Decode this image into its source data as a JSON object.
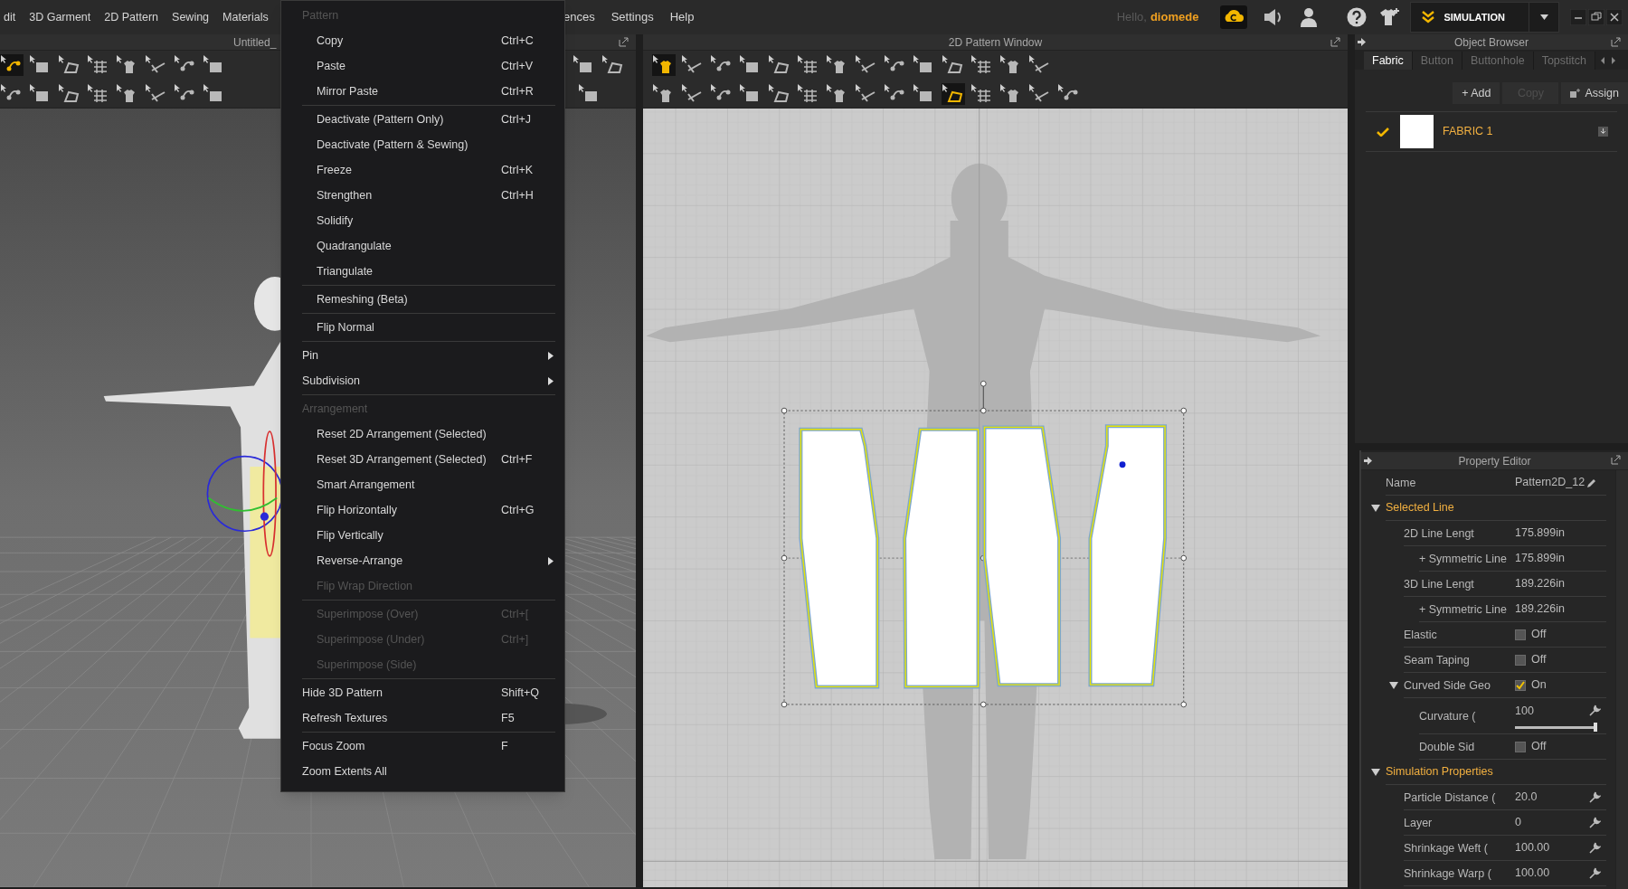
{
  "menu_bar": {
    "left": [
      {
        "label": "dit"
      },
      {
        "label": "3D Garment"
      },
      {
        "label": "2D Pattern"
      },
      {
        "label": "Sewing"
      },
      {
        "label": "Materials"
      }
    ],
    "right": [
      {
        "label": "ences"
      },
      {
        "label": "Settings"
      },
      {
        "label": "Help"
      }
    ]
  },
  "user": {
    "greeting": "Hello,",
    "name": "diomede"
  },
  "simulation_button": {
    "label": "SIMULATION"
  },
  "viewport_3d": {
    "title": "Untitled_"
  },
  "pattern_window": {
    "title": "2D Pattern Window"
  },
  "toolbars": {
    "viewport_3d": {
      "row_1_left": [
        {
          "selected": true
        },
        {
          "selected": false
        },
        {
          "selected": false
        },
        {
          "selected": false
        },
        {
          "selected": false
        },
        {
          "selected": false
        },
        {
          "selected": false
        },
        {
          "selected": false
        }
      ],
      "row_1_right": [
        {
          "selected": false
        },
        {
          "selected": false
        }
      ],
      "row_2_left": [
        {
          "selected": false
        },
        {
          "selected": false
        },
        {
          "selected": false
        },
        {
          "selected": false
        },
        {
          "selected": false
        },
        {
          "selected": false
        },
        {
          "selected": false
        },
        {
          "selected": false
        }
      ],
      "row_2_right": [
        {
          "selected": false
        }
      ]
    },
    "pattern_window": {
      "row_1": [
        {
          "selected": true
        },
        {
          "selected": false
        },
        {
          "selected": false
        },
        {
          "selected": false
        },
        {
          "selected": false
        },
        {
          "selected": false
        },
        {
          "selected": false
        },
        {
          "selected": false
        },
        {
          "selected": false
        },
        {
          "selected": false
        },
        {
          "selected": false
        },
        {
          "selected": false
        },
        {
          "selected": false
        },
        {
          "selected": false
        }
      ],
      "row_2": [
        {
          "selected": false
        },
        {
          "selected": false
        },
        {
          "selected": false
        },
        {
          "selected": false
        },
        {
          "selected": false
        },
        {
          "selected": false
        },
        {
          "selected": false
        },
        {
          "selected": false
        },
        {
          "selected": false
        },
        {
          "selected": false
        },
        {
          "selected": true
        },
        {
          "selected": false
        },
        {
          "selected": false
        },
        {
          "selected": false
        },
        {
          "selected": false
        }
      ]
    }
  },
  "context_menu": {
    "sections": [
      {
        "header": "Pattern",
        "items": [
          {
            "kind": "indented",
            "label": "Copy",
            "shortcut": "Ctrl+C",
            "disabled": false
          },
          {
            "kind": "indented",
            "label": "Paste",
            "shortcut": "Ctrl+V",
            "disabled": false
          },
          {
            "kind": "indented",
            "label": "Mirror Paste",
            "shortcut": "Ctrl+R",
            "disabled": false
          }
        ]
      },
      {
        "items": [
          {
            "kind": "indented",
            "label": "Deactivate (Pattern Only)",
            "shortcut": "Ctrl+J",
            "disabled": false
          },
          {
            "kind": "indented",
            "label": "Deactivate (Pattern & Sewing)",
            "disabled": false
          },
          {
            "kind": "indented",
            "label": "Freeze",
            "shortcut": "Ctrl+K",
            "disabled": false
          },
          {
            "kind": "indented",
            "label": "Strengthen",
            "shortcut": "Ctrl+H",
            "disabled": false
          },
          {
            "kind": "indented",
            "label": "Solidify",
            "disabled": false
          },
          {
            "kind": "indented",
            "label": "Quadrangulate",
            "disabled": false
          },
          {
            "kind": "indented",
            "label": "Triangulate",
            "disabled": false
          }
        ]
      },
      {
        "items": [
          {
            "kind": "indented",
            "label": "Remeshing (Beta)",
            "disabled": false
          }
        ]
      },
      {
        "items": [
          {
            "kind": "indented",
            "label": "Flip Normal",
            "disabled": false
          }
        ]
      },
      {
        "items": [
          {
            "kind": "plain",
            "label": "Pin",
            "submenu": true,
            "disabled": false
          },
          {
            "kind": "plain",
            "label": "Subdivision",
            "submenu": true,
            "disabled": false
          }
        ]
      },
      {
        "header": "Arrangement",
        "items": [
          {
            "kind": "indented",
            "label": "Reset 2D Arrangement (Selected)",
            "disabled": false
          },
          {
            "kind": "indented",
            "label": "Reset 3D Arrangement (Selected)",
            "shortcut": "Ctrl+F",
            "disabled": false
          },
          {
            "kind": "indented",
            "label": "Smart Arrangement",
            "disabled": false
          },
          {
            "kind": "indented",
            "label": "Flip Horizontally",
            "shortcut": "Ctrl+G",
            "disabled": false
          },
          {
            "kind": "indented",
            "label": "Flip Vertically",
            "disabled": false
          },
          {
            "kind": "indented",
            "label": "Reverse-Arrange",
            "submenu": true,
            "disabled": false
          },
          {
            "kind": "indented",
            "label": "Flip Wrap Direction",
            "disabled": true
          }
        ]
      },
      {
        "items": [
          {
            "kind": "indented",
            "label": "Superimpose (Over)",
            "shortcut": "Ctrl+[",
            "disabled": true
          },
          {
            "kind": "indented",
            "label": "Superimpose (Under)",
            "shortcut": "Ctrl+]",
            "disabled": true
          },
          {
            "kind": "indented",
            "label": "Superimpose (Side)",
            "disabled": true
          }
        ]
      },
      {
        "items": [
          {
            "kind": "plain",
            "label": "Hide 3D Pattern",
            "shortcut": "Shift+Q",
            "disabled": false
          },
          {
            "kind": "plain",
            "label": "Refresh Textures",
            "shortcut": "F5",
            "disabled": false
          }
        ]
      },
      {
        "items": [
          {
            "kind": "plain",
            "label": "Focus Zoom",
            "shortcut": "F",
            "disabled": false
          },
          {
            "kind": "plain",
            "label": "Zoom Extents All",
            "disabled": false
          }
        ]
      }
    ]
  },
  "object_browser": {
    "title": "Object Browser",
    "tabs": [
      {
        "label": "Fabric",
        "selected": true
      },
      {
        "label": "Button",
        "selected": false
      },
      {
        "label": "Buttonhole",
        "selected": false
      },
      {
        "label": "Topstitch",
        "selected": false
      }
    ],
    "buttons": [
      {
        "kind": "add",
        "label": "+ Add",
        "disabled": false
      },
      {
        "kind": "copy",
        "label": "Copy",
        "disabled": true
      },
      {
        "kind": "assign",
        "label": "Assign",
        "disabled": false
      }
    ],
    "fabrics": [
      {
        "label": "FABRIC 1",
        "checked": true,
        "color": "#ffffff"
      }
    ]
  },
  "property_editor": {
    "title": "Property Editor",
    "rows": [
      {
        "kind": "field",
        "label": "Name",
        "value": "Pattern2D_12",
        "editable": true
      },
      {
        "kind": "group",
        "label": "Selected Line",
        "expanded": true,
        "children": [
          {
            "kind": "field",
            "label": "2D Line Lengt",
            "value": "175.899in",
            "children": [
              {
                "kind": "field",
                "label": "+ Symmetric Line",
                "value": "175.899in"
              }
            ]
          },
          {
            "kind": "field",
            "label": "3D Line Lengt",
            "value": "189.226in",
            "children": [
              {
                "kind": "field",
                "label": "+ Symmetric Line",
                "value": "189.226in"
              }
            ]
          },
          {
            "kind": "toggle",
            "label": "Elastic",
            "checked": false,
            "value": "Off"
          },
          {
            "kind": "toggle",
            "label": "Seam Taping",
            "checked": false,
            "value": "Off"
          },
          {
            "kind": "toggle",
            "label": "Curved Side Geo",
            "checked": true,
            "value": "On",
            "expanded": true,
            "children": [
              {
                "kind": "slider",
                "label": "Curvature (",
                "value": "100",
                "level": 1.0,
                "adjustable": true
              },
              {
                "kind": "toggle",
                "label": "Double Sid",
                "checked": false,
                "value": "Off"
              }
            ]
          }
        ]
      },
      {
        "kind": "group",
        "label": "Simulation Properties",
        "expanded": true,
        "children": [
          {
            "kind": "field",
            "label": "Particle Distance (",
            "value": "20.0",
            "adjustable": true
          },
          {
            "kind": "field",
            "label": "Layer",
            "value": "0",
            "adjustable": true
          },
          {
            "kind": "field",
            "label": "Shrinkage Weft (",
            "value": "100.00",
            "adjustable": true
          },
          {
            "kind": "field",
            "label": "Shrinkage Warp (",
            "value": "100.00",
            "adjustable": true
          }
        ]
      }
    ]
  }
}
